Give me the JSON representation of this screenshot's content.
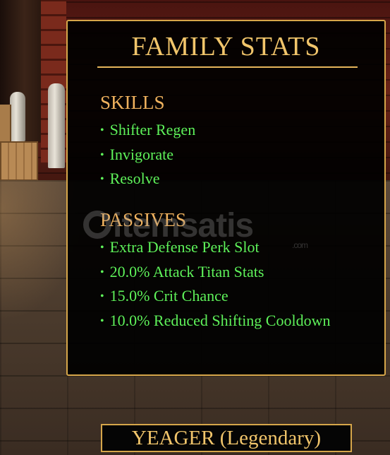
{
  "panel": {
    "title": "FAMILY STATS",
    "skills": {
      "heading": "SKILLS",
      "items": [
        "Shifter Regen",
        "Invigorate",
        "Resolve"
      ]
    },
    "passives": {
      "heading": "PASSIVES",
      "items": [
        "Extra Defense Perk Slot",
        "20.0% Attack Titan Stats",
        "15.0% Crit Chance",
        "10.0% Reduced Shifting Cooldown"
      ]
    }
  },
  "watermark": {
    "text": "itemsatis",
    "suffix": ".com"
  },
  "nameplate": {
    "label": "YEAGER (Legendary)"
  },
  "colors": {
    "accent_gold": "#d6a64a",
    "title_gold": "#f1c56b",
    "heading_orange": "#f0b25e",
    "stat_green": "#5ff25a",
    "panel_bg": "#000000"
  },
  "bullet": "•"
}
